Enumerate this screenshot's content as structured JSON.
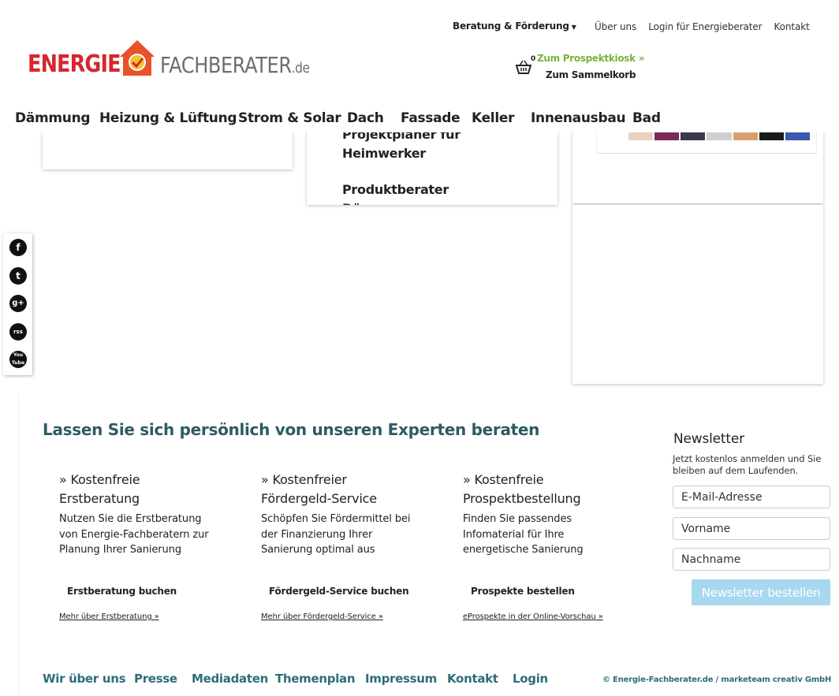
{
  "header": {
    "beratung_label": "Beratung & Förderung",
    "top_links": [
      "Über uns",
      "Login für Energieberater",
      "Kontakt"
    ],
    "logo": {
      "part1": "ENERGIE",
      "part2": "FACHBERATER",
      "tld": ".de"
    },
    "basket_count": "0",
    "kiosk_label": "Zum Prospektkiosk »",
    "sammel_label": "Zum Sammelkorb"
  },
  "main_nav": [
    "Dämmung",
    "Heizung & Lüftung",
    "Strom & Solar",
    "Dach",
    "Fassade",
    "Keller",
    "Innenausbau",
    "Bad"
  ],
  "middle_box": {
    "items": [
      "Projektplaner für Heimwerker",
      "Produktberater Dämmung"
    ]
  },
  "social": [
    "f",
    "t",
    "g+",
    "rss",
    "You Tube"
  ],
  "experts": {
    "title": "Lassen Sie sich persönlich von unseren Experten beraten",
    "columns": [
      {
        "heading": "» Kostenfreie Erstberatung",
        "text": "Nutzen Sie die Erstberatung von Energie-Fachberatern zur Planung Ihrer Sanierung",
        "button": "Erstberatung buchen",
        "more": "Mehr über Erstberatung »"
      },
      {
        "heading": "» Kostenfreier Fördergeld-Service",
        "text": "Schöpfen Sie Fördermittel bei der Finanzierung Ihrer Sanierung optimal aus",
        "button": "Fördergeld-Service buchen",
        "more": "Mehr über Fördergeld-Service »"
      },
      {
        "heading": "» Kostenfreie Prospektbestellung",
        "text": "Finden Sie passendes Infomaterial für Ihre energetische Sanierung",
        "button": "Prospekte bestellen",
        "more": "eProspekte in der Online-Vorschau »"
      }
    ]
  },
  "newsletter": {
    "title": "Newsletter",
    "subtitle": "Jetzt kostenlos anmelden und Sie bleiben auf dem Laufenden.",
    "email_placeholder": "E-Mail-Adresse",
    "first_name_placeholder": "Vorname",
    "last_name_placeholder": "Nachname",
    "button": "Newsletter bestellen"
  },
  "footer": {
    "links": [
      "Wir über uns",
      "Presse",
      "Mediadaten",
      "Themenplan",
      "Impressum",
      "Kontakt",
      "Login"
    ],
    "copyright": "© Energie-Fachberater.de / marketeam creativ GmbH"
  },
  "colors": {
    "brand_red": "#d6262e",
    "brand_green": "#7ab23c",
    "teal": "#2d5b63",
    "button_blue": "#a8d7f0"
  }
}
